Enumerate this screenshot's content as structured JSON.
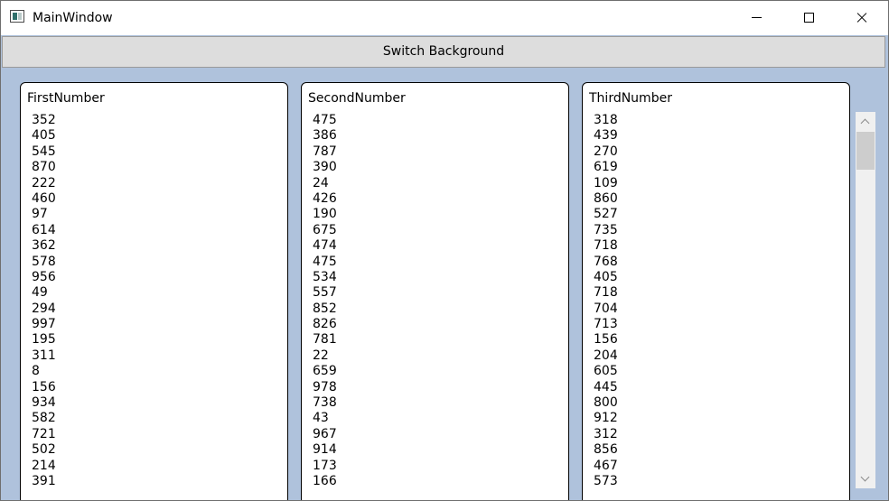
{
  "window": {
    "title": "MainWindow"
  },
  "toolbar": {
    "switch_label": "Switch Background"
  },
  "columns": [
    {
      "header": "FirstNumber",
      "items": [
        "352",
        "405",
        "545",
        "870",
        "222",
        "460",
        "97",
        "614",
        "362",
        "578",
        "956",
        "49",
        "294",
        "997",
        "195",
        "311",
        "8",
        "156",
        "934",
        "582",
        "721",
        "502",
        "214",
        "391"
      ]
    },
    {
      "header": "SecondNumber",
      "items": [
        "475",
        "386",
        "787",
        "390",
        "24",
        "426",
        "190",
        "675",
        "474",
        "475",
        "534",
        "557",
        "852",
        "826",
        "781",
        "22",
        "659",
        "978",
        "738",
        "43",
        "967",
        "914",
        "173",
        "166"
      ]
    },
    {
      "header": "ThirdNumber",
      "items": [
        "318",
        "439",
        "270",
        "619",
        "109",
        "860",
        "527",
        "735",
        "718",
        "768",
        "405",
        "718",
        "704",
        "713",
        "156",
        "204",
        "605",
        "445",
        "800",
        "912",
        "312",
        "856",
        "467",
        "573"
      ]
    }
  ],
  "colors": {
    "client_background": "#afc2dc",
    "button_background": "#dddddd"
  }
}
